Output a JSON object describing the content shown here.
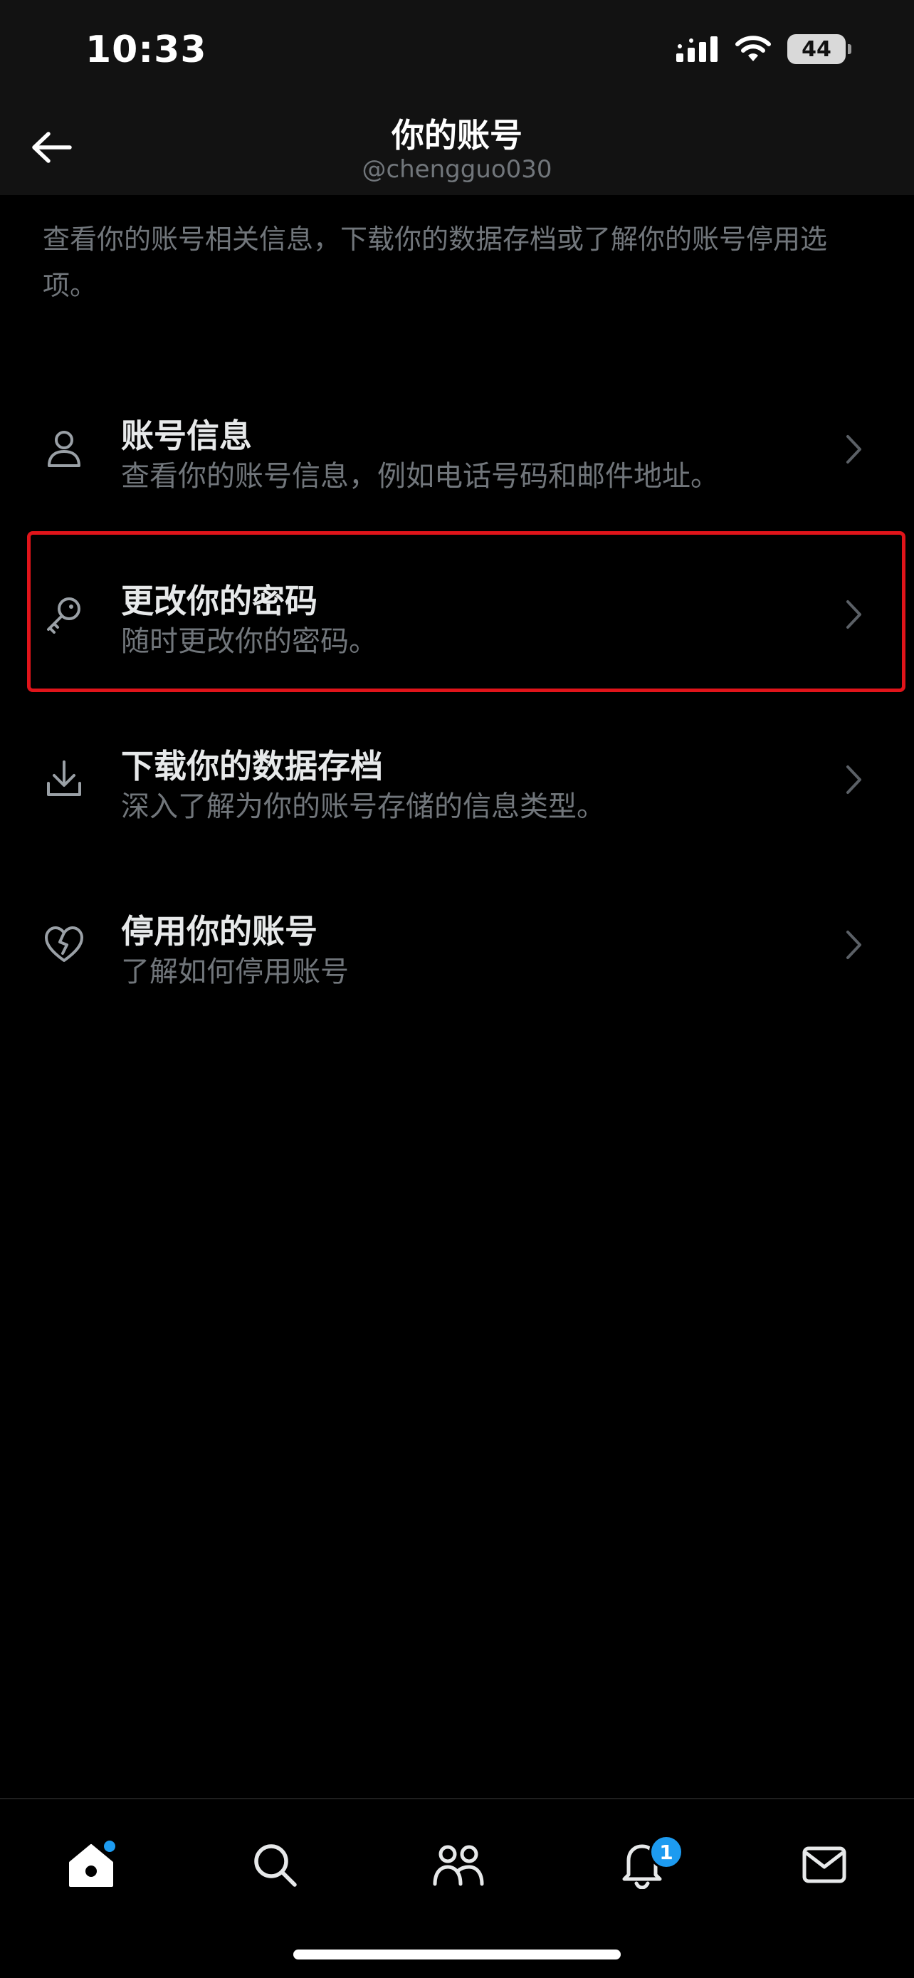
{
  "status_bar": {
    "time": "10:33",
    "battery_level": "44"
  },
  "header": {
    "title": "你的账号",
    "subtitle": "@chengguo030"
  },
  "description": "查看你的账号相关信息，下载你的数据存档或了解你的账号停用选项。",
  "menu": [
    {
      "title": "账号信息",
      "desc": "查看你的账号信息，例如电话号码和邮件地址。",
      "icon": "person-icon"
    },
    {
      "title": "更改你的密码",
      "desc": "随时更改你的密码。",
      "icon": "key-icon",
      "highlighted": true
    },
    {
      "title": "下载你的数据存档",
      "desc": "深入了解为你的账号存储的信息类型。",
      "icon": "download-icon"
    },
    {
      "title": "停用你的账号",
      "desc": "了解如何停用账号",
      "icon": "broken-heart-icon"
    }
  ],
  "tabs": [
    {
      "name": "home",
      "icon": "home-icon",
      "has_dot": true
    },
    {
      "name": "search",
      "icon": "search-icon"
    },
    {
      "name": "communities",
      "icon": "people-icon"
    },
    {
      "name": "notifications",
      "icon": "bell-icon",
      "badge": "1"
    },
    {
      "name": "messages",
      "icon": "mail-icon"
    }
  ],
  "colors": {
    "accent": "#1d9bf0",
    "highlight_border": "#e0141a",
    "secondary_text": "#71767b"
  }
}
